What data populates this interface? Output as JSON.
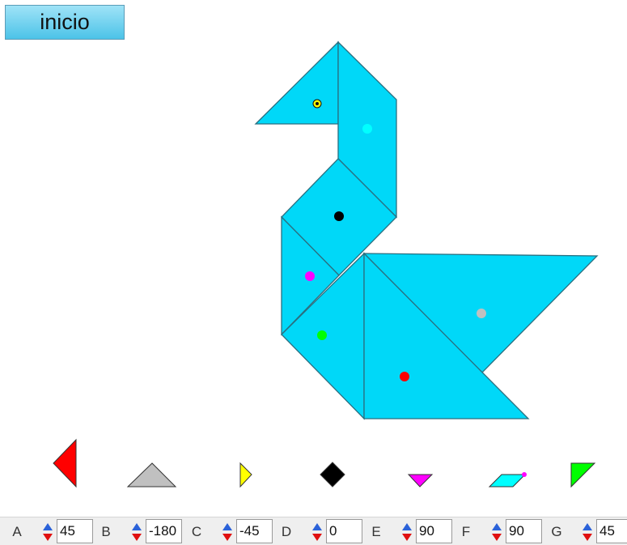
{
  "header": {
    "inicio_label": "inicio"
  },
  "colors": {
    "piece_fill": "#00d8f8",
    "piece_stroke": "#2a6f80",
    "red": "#ff0000",
    "gray": "#c0c0c0",
    "yellow": "#ffff00",
    "black": "#000000",
    "magenta": "#ff00ff",
    "cyan": "#00ffff",
    "green": "#00ff00"
  },
  "palette": [
    {
      "name": "red-triangle-piece",
      "color": "red"
    },
    {
      "name": "gray-triangle-piece",
      "color": "gray"
    },
    {
      "name": "yellow-triangle-piece",
      "color": "yellow"
    },
    {
      "name": "black-square-piece",
      "color": "black"
    },
    {
      "name": "magenta-triangle-piece",
      "color": "magenta"
    },
    {
      "name": "cyan-parallelogram-piece",
      "color": "cyan"
    },
    {
      "name": "green-triangle-piece",
      "color": "green"
    }
  ],
  "controls": [
    {
      "label": "A",
      "value": "45"
    },
    {
      "label": "B",
      "value": "-180"
    },
    {
      "label": "C",
      "value": "-45"
    },
    {
      "label": "D",
      "value": "0"
    },
    {
      "label": "E",
      "value": "90"
    },
    {
      "label": "F",
      "value": "90"
    },
    {
      "label": "G",
      "value": "45"
    }
  ]
}
